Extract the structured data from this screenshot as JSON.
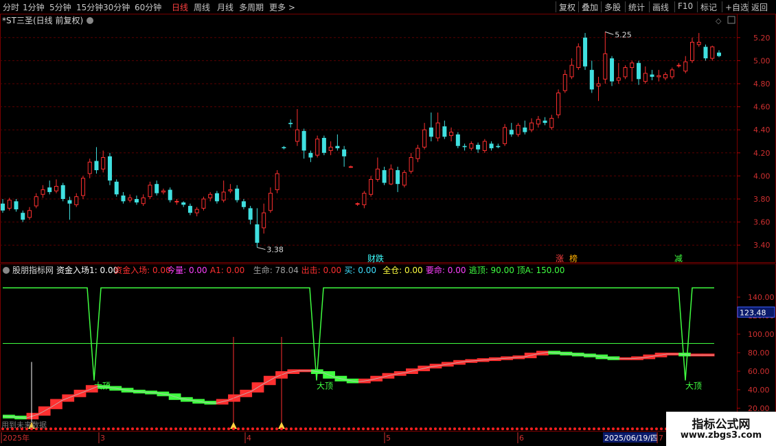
{
  "toolbar": {
    "periods": [
      "分时",
      "1分钟",
      "5分钟",
      "15分钟",
      "30分钟",
      "60分钟",
      "日线",
      "周线",
      "月线",
      "多周期",
      "更多 >"
    ],
    "active_period": "日线",
    "right_buttons": [
      "复权",
      "叠加",
      "多股",
      "统计",
      "画线",
      "F10",
      "标记",
      "+自选",
      "返回"
    ]
  },
  "stock": {
    "title": "*ST三圣(日线 前复权)",
    "high_label": "5.25",
    "low_label": "3.38",
    "markers": [
      {
        "text": "财",
        "color": "#40ffff"
      },
      {
        "text": "跌",
        "color": "#40ffff"
      },
      {
        "text": "涨",
        "color": "#ff4040"
      },
      {
        "text": "榜",
        "color": "#ffb000"
      },
      {
        "text": "减",
        "color": "#40ff40"
      }
    ]
  },
  "price_axis": [
    "5.20",
    "5.00",
    "4.80",
    "4.60",
    "4.40",
    "4.20",
    "4.00",
    "3.80",
    "3.60",
    "3.40"
  ],
  "indicator": {
    "name": "股朋指标网",
    "items": [
      {
        "label": "资金入场1: 0.00",
        "color": "#ffffff"
      },
      {
        "label": "资金入场: 0.00",
        "color": "#ff3030"
      },
      {
        "label": "今量: 0.00",
        "color": "#ff40ff"
      },
      {
        "label": "A1: 0.00",
        "color": "#ff3030"
      },
      {
        "label": "生命: 78.04",
        "color": "#a0a0a0"
      },
      {
        "label": "出击: 0.00",
        "color": "#ff3030"
      },
      {
        "label": "买: 0.00",
        "color": "#40e0ff"
      },
      {
        "label": "全仓: 0.00",
        "color": "#ffff40"
      },
      {
        "label": "要命: 0.00",
        "color": "#ff40ff"
      },
      {
        "label": "逃顶: 90.00",
        "color": "#40ff40"
      },
      {
        "label": "顶A: 150.00",
        "color": "#40ff40"
      }
    ],
    "axis": [
      "140.00",
      "120.00",
      "100.00",
      "80.00",
      "60.00",
      "40.00",
      "20.00"
    ],
    "current_value": "123.48",
    "top_labels": [
      "大顶",
      "大顶",
      "大顶"
    ]
  },
  "footer": {
    "left_text": "用到未来数据",
    "dates": [
      "2025年",
      "3",
      "4",
      "5",
      "6",
      "2025/06/19/四",
      "7"
    ]
  },
  "watermark": {
    "title": "指标公式网",
    "url": "www.zbgs3.com"
  },
  "colors": {
    "up": "#ff3030",
    "down": "#40e0e0",
    "grid": "#5a0000",
    "green": "#40ff40"
  },
  "chart_data": {
    "type": "candlestick",
    "ylim": [
      3.3,
      5.3
    ],
    "candles": [
      [
        3.76,
        3.7,
        3.8,
        3.68
      ],
      [
        3.72,
        3.79,
        3.81,
        3.7
      ],
      [
        3.78,
        3.71,
        3.8,
        3.69
      ],
      [
        3.68,
        3.62,
        3.7,
        3.6
      ],
      [
        3.64,
        3.7,
        3.73,
        3.62
      ],
      [
        3.74,
        3.82,
        3.85,
        3.72
      ],
      [
        3.84,
        3.88,
        3.92,
        3.81
      ],
      [
        3.9,
        3.86,
        3.96,
        3.84
      ],
      [
        3.87,
        3.91,
        3.97,
        3.85
      ],
      [
        3.92,
        3.8,
        3.94,
        3.78
      ],
      [
        3.79,
        3.76,
        3.82,
        3.62
      ],
      [
        3.75,
        3.82,
        3.85,
        3.73
      ],
      [
        3.83,
        3.98,
        4.0,
        3.8
      ],
      [
        4.02,
        4.12,
        4.15,
        3.98
      ],
      [
        4.13,
        4.05,
        4.25,
        4.02
      ],
      [
        4.06,
        4.16,
        4.22,
        4.03
      ],
      [
        4.17,
        3.96,
        4.2,
        3.92
      ],
      [
        3.95,
        3.84,
        3.97,
        3.82
      ],
      [
        3.83,
        3.78,
        3.86,
        3.76
      ],
      [
        3.79,
        3.81,
        3.84,
        3.77
      ],
      [
        3.8,
        3.77,
        3.83,
        3.75
      ],
      [
        3.76,
        3.81,
        3.84,
        3.74
      ],
      [
        3.82,
        3.92,
        3.95,
        3.8
      ],
      [
        3.93,
        3.85,
        3.96,
        3.83
      ],
      [
        3.86,
        3.87,
        3.89,
        3.84
      ],
      [
        3.88,
        3.79,
        3.9,
        3.77
      ],
      [
        3.78,
        3.78,
        3.8,
        3.75
      ],
      [
        3.77,
        3.75,
        3.78,
        3.73
      ],
      [
        3.74,
        3.68,
        3.76,
        3.66
      ],
      [
        3.68,
        3.71,
        3.73,
        3.65
      ],
      [
        3.72,
        3.8,
        3.82,
        3.7
      ],
      [
        3.81,
        3.84,
        3.86,
        3.78
      ],
      [
        3.85,
        3.78,
        3.87,
        3.76
      ],
      [
        3.79,
        3.86,
        3.96,
        3.77
      ],
      [
        3.87,
        3.88,
        3.93,
        3.85
      ],
      [
        3.89,
        3.79,
        3.92,
        3.77
      ],
      [
        3.78,
        3.73,
        3.8,
        3.71
      ],
      [
        3.72,
        3.62,
        3.74,
        3.58
      ],
      [
        3.58,
        3.42,
        3.72,
        3.38
      ],
      [
        3.55,
        3.68,
        3.76,
        3.5
      ],
      [
        3.7,
        3.85,
        3.9,
        3.68
      ],
      [
        3.88,
        4.02,
        4.05,
        3.85
      ],
      [
        4.25,
        4.24,
        4.26,
        4.23
      ],
      [
        4.46,
        4.45,
        4.49,
        4.42
      ],
      [
        4.3,
        4.4,
        4.58,
        4.26
      ],
      [
        4.39,
        4.22,
        4.41,
        4.15
      ],
      [
        4.2,
        4.16,
        4.22,
        4.12
      ],
      [
        4.18,
        4.32,
        4.35,
        4.16
      ],
      [
        4.33,
        4.2,
        4.35,
        4.18
      ],
      [
        4.22,
        4.25,
        4.3,
        4.18
      ],
      [
        4.26,
        4.24,
        4.36,
        4.22
      ],
      [
        4.23,
        4.17,
        4.26,
        4.08
      ],
      [
        4.08,
        4.08,
        4.09,
        4.07
      ],
      [
        3.76,
        3.76,
        3.77,
        3.74
      ],
      [
        3.75,
        3.85,
        3.87,
        3.72
      ],
      [
        3.84,
        3.97,
        4.0,
        3.82
      ],
      [
        3.97,
        4.06,
        4.16,
        3.95
      ],
      [
        4.05,
        3.94,
        4.08,
        3.92
      ],
      [
        3.93,
        4.06,
        4.1,
        3.92
      ],
      [
        4.05,
        3.93,
        4.08,
        3.86
      ],
      [
        3.92,
        4.03,
        4.05,
        3.9
      ],
      [
        4.04,
        4.16,
        4.2,
        4.02
      ],
      [
        4.15,
        4.24,
        4.27,
        4.12
      ],
      [
        4.25,
        4.4,
        4.46,
        4.23
      ],
      [
        4.42,
        4.34,
        4.55,
        4.3
      ],
      [
        4.33,
        4.46,
        4.55,
        4.3
      ],
      [
        4.43,
        4.34,
        4.48,
        4.32
      ],
      [
        4.35,
        4.38,
        4.42,
        4.3
      ],
      [
        4.36,
        4.26,
        4.38,
        4.24
      ],
      [
        4.26,
        4.25,
        4.28,
        4.22
      ],
      [
        4.24,
        4.28,
        4.3,
        4.22
      ],
      [
        4.27,
        4.23,
        4.29,
        4.2
      ],
      [
        4.22,
        4.3,
        4.32,
        4.2
      ],
      [
        4.28,
        4.24,
        4.3,
        4.22
      ],
      [
        4.26,
        4.25,
        4.28,
        4.24
      ],
      [
        4.28,
        4.42,
        4.45,
        4.26
      ],
      [
        4.4,
        4.36,
        4.46,
        4.34
      ],
      [
        4.36,
        4.44,
        4.46,
        4.34
      ],
      [
        4.42,
        4.38,
        4.48,
        4.36
      ],
      [
        4.4,
        4.46,
        4.5,
        4.38
      ],
      [
        4.45,
        4.49,
        4.52,
        4.42
      ],
      [
        4.48,
        4.46,
        4.51,
        4.44
      ],
      [
        4.42,
        4.5,
        4.53,
        4.4
      ],
      [
        4.53,
        4.72,
        4.75,
        4.5
      ],
      [
        4.74,
        4.88,
        4.92,
        4.72
      ],
      [
        4.86,
        4.96,
        5.02,
        4.84
      ],
      [
        4.94,
        5.12,
        5.15,
        4.92
      ],
      [
        5.2,
        4.95,
        5.24,
        4.92
      ],
      [
        4.92,
        4.75,
        5.0,
        4.72
      ],
      [
        4.78,
        4.8,
        4.86,
        4.65
      ],
      [
        4.84,
        5.06,
        5.25,
        4.8
      ],
      [
        5.02,
        4.82,
        5.04,
        4.78
      ],
      [
        4.83,
        4.85,
        4.98,
        4.8
      ],
      [
        4.86,
        4.94,
        4.96,
        4.84
      ],
      [
        4.94,
        4.98,
        5.0,
        4.82
      ],
      [
        4.98,
        4.84,
        5.0,
        4.79
      ],
      [
        4.82,
        4.89,
        4.95,
        4.8
      ],
      [
        4.88,
        4.86,
        4.92,
        4.83
      ],
      [
        4.86,
        4.87,
        4.92,
        4.82
      ],
      [
        4.85,
        4.88,
        4.9,
        4.83
      ],
      [
        4.86,
        4.92,
        4.94,
        4.84
      ],
      [
        4.96,
        4.96,
        4.98,
        4.94
      ],
      [
        4.91,
        4.99,
        5.04,
        4.89
      ],
      [
        5.0,
        5.16,
        5.2,
        4.98
      ],
      [
        5.14,
        5.16,
        5.24,
        5.12
      ],
      [
        5.12,
        5.02,
        5.14,
        5.0
      ],
      [
        5.02,
        5.12,
        5.13,
        5.0
      ],
      [
        5.07,
        5.04,
        5.09,
        5.03
      ]
    ],
    "indicator": {
      "ylim": [
        0,
        160
      ],
      "top_line": [
        150,
        150,
        150,
        150,
        150,
        150,
        150,
        150,
        150,
        150,
        150,
        150,
        150,
        150,
        150,
        150,
        150,
        150,
        150,
        150,
        150,
        150,
        150,
        150,
        150,
        150,
        150,
        150,
        150,
        150,
        150,
        150,
        150,
        150,
        150,
        150,
        150,
        150,
        150,
        150,
        150,
        150,
        150,
        150,
        150,
        150,
        150,
        150,
        150,
        150,
        150,
        150,
        150,
        150,
        150,
        150,
        150,
        150,
        150,
        150,
        150
      ],
      "escape_line": 90,
      "band": [
        13,
        12,
        11,
        15,
        22,
        30,
        35,
        40,
        45,
        44,
        42,
        40,
        39,
        38,
        36,
        32,
        30,
        28,
        27,
        30,
        35,
        40,
        48,
        55,
        60,
        62,
        62,
        60,
        55,
        52,
        50,
        52,
        55,
        58,
        60,
        63,
        66,
        68,
        70,
        72,
        73,
        74,
        75,
        76,
        77,
        80,
        82,
        81,
        80,
        79,
        78,
        76,
        75,
        75,
        76,
        78,
        80,
        80,
        79,
        79,
        79
      ]
    }
  }
}
